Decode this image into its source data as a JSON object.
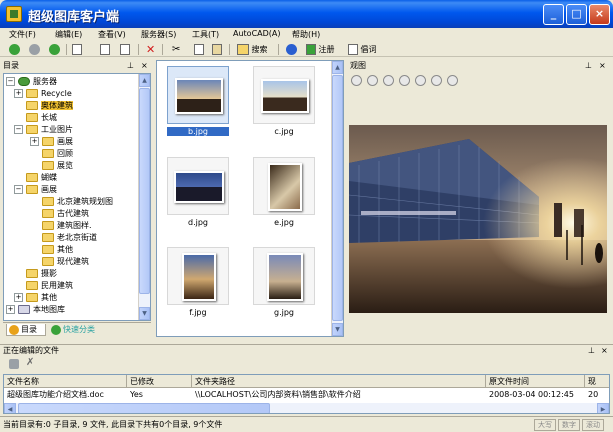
{
  "window": {
    "title": "超级图库客户端"
  },
  "menu": [
    "文件(F)",
    "编辑(E)",
    "查看(V)",
    "服务器(S)",
    "工具(T)",
    "AutoCAD(A)",
    "帮助(H)"
  ],
  "toolbar": {
    "search_label": "搜索",
    "register_label": "注册",
    "slogan_label": "倡词"
  },
  "tree_panel": {
    "title": "目录",
    "items": [
      {
        "label": "服务器",
        "level": 0,
        "type": "server",
        "expander": "−"
      },
      {
        "label": "Recycle",
        "level": 1,
        "expander": "+"
      },
      {
        "label": "奥体建筑",
        "level": 1,
        "selected": true
      },
      {
        "label": "长城",
        "level": 1
      },
      {
        "label": "工业图片",
        "level": 1,
        "expander": "−"
      },
      {
        "label": "画展",
        "level": 2,
        "expander": "+"
      },
      {
        "label": "回顾",
        "level": 2
      },
      {
        "label": "展览",
        "level": 2
      },
      {
        "label": "蝴蝶",
        "level": 1
      },
      {
        "label": "画展",
        "level": 1,
        "expander": "−"
      },
      {
        "label": "北京建筑规划图",
        "level": 2
      },
      {
        "label": "古代建筑",
        "level": 2
      },
      {
        "label": "建筑图样.",
        "level": 2
      },
      {
        "label": "老北京街道",
        "level": 2
      },
      {
        "label": "其他",
        "level": 2
      },
      {
        "label": "现代建筑",
        "level": 2
      },
      {
        "label": "摄影",
        "level": 1
      },
      {
        "label": "民用建筑",
        "level": 1
      },
      {
        "label": "其他",
        "level": 1,
        "expander": "+"
      },
      {
        "label": "本地图库",
        "level": 0,
        "type": "local",
        "expander": "+"
      }
    ],
    "tabs": [
      "目录",
      "快速分类"
    ]
  },
  "thumbnails": [
    {
      "label": "b.jpg",
      "selected": true
    },
    {
      "label": "c.jpg"
    },
    {
      "label": "d.jpg"
    },
    {
      "label": "e.jpg"
    },
    {
      "label": "f.jpg"
    },
    {
      "label": "g.jpg"
    }
  ],
  "preview": {
    "title": "观图"
  },
  "editing_panel": {
    "title": "正在编辑的文件",
    "columns": [
      "文件名称",
      "已修改",
      "文件夹路径",
      "原文件时间",
      "现"
    ],
    "rows": [
      {
        "name": "超级图库功能介绍文档.doc",
        "modified": "Yes",
        "path": "\\\\LOCALHOST\\公司内部资料\\销售部\\软件介绍",
        "time": "2008-03-04 00:12:45",
        "extra": "20"
      }
    ]
  },
  "statusbar": {
    "text": "当前目录有:0 子目录, 9 文件, 此目录下共有0个目录, 9个文件",
    "indicators": [
      "大写",
      "数字",
      "滚动"
    ]
  },
  "colors": {
    "title_blue": "#0054e3",
    "selection": "#316ac5",
    "folder": "#f5d469"
  }
}
